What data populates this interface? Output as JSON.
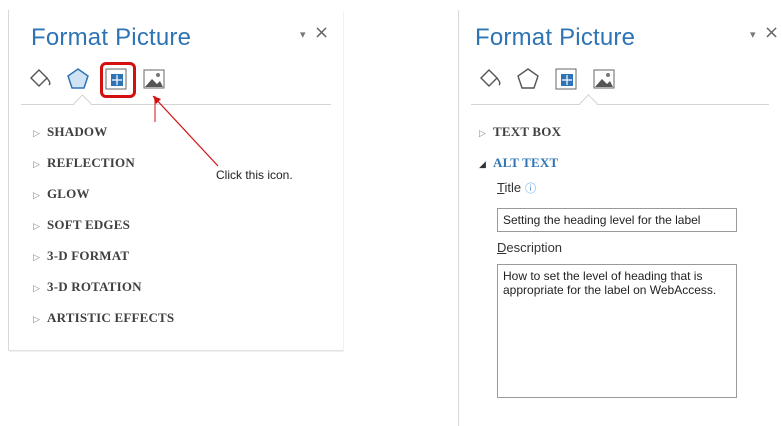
{
  "left_panel": {
    "title": "Format Picture",
    "pin": "▾",
    "close": "×",
    "icons": [
      "fill-line-icon",
      "effects-icon",
      "size-properties-icon",
      "picture-icon"
    ],
    "sections": [
      "SHADOW",
      "REFLECTION",
      "GLOW",
      "SOFT EDGES",
      "3-D FORMAT",
      "3-D ROTATION",
      "ARTISTIC EFFECTS"
    ]
  },
  "annotation": {
    "text": "Click this icon.",
    "color": "#d21010"
  },
  "right_panel": {
    "title": "Format Picture",
    "pin": "▾",
    "close": "×",
    "sections": [
      "TEXT BOX",
      "ALT TEXT"
    ],
    "title_label_underline": "T",
    "title_label_rest": "itle",
    "title_value": "Setting the heading level for the label",
    "description_label_underline": "D",
    "description_label_rest": "escription",
    "description_value": "How to set the level of heading that is appropriate for the label on WebAccess."
  },
  "colors": {
    "title": "#2e74b5",
    "accent": "#2e74b5"
  }
}
